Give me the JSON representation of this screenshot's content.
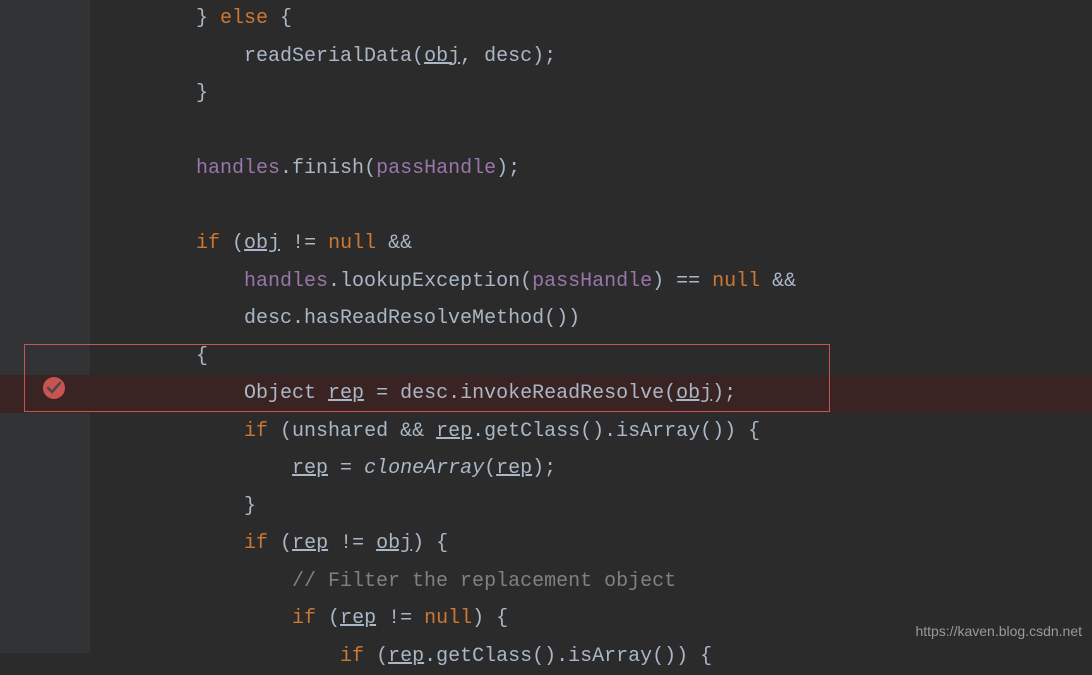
{
  "code": {
    "l0a": "        } ",
    "l0b": "else",
    "l0c": " {",
    "l1a": "            readSerialData(",
    "l1b": "obj",
    "l1c": ", desc);",
    "l2": "        }",
    "l3": "",
    "l4a": "        ",
    "l4b": "handles",
    "l4c": ".",
    "l4d": "finish",
    "l4e": "(",
    "l4f": "passHandle",
    "l4g": ");",
    "l5": "",
    "l6a": "        ",
    "l6b": "if",
    "l6c": " (",
    "l6d": "obj",
    "l6e": " != ",
    "l6f": "null",
    "l6g": " &&",
    "l7a": "            ",
    "l7b": "handles",
    "l7c": ".lookupException(",
    "l7d": "passHandle",
    "l7e": ") == ",
    "l7f": "null",
    "l7g": " &&",
    "l8a": "            desc.hasReadResolveMethod())",
    "l9": "        {",
    "l10a": "            Object ",
    "l10b": "rep",
    "l10c": " = desc.invokeReadResolve(",
    "l10d": "obj",
    "l10e": ");",
    "l11a": "            ",
    "l11b": "if",
    "l11c": " (unshared && ",
    "l11d": "rep",
    "l11e": ".getClass().isArray()) {",
    "l12a": "                ",
    "l12b": "rep",
    "l12c": " = ",
    "l12d": "cloneArray",
    "l12e": "(",
    "l12f": "rep",
    "l12g": ");",
    "l13": "            }",
    "l14a": "            ",
    "l14b": "if",
    "l14c": " (",
    "l14d": "rep",
    "l14e": " != ",
    "l14f": "obj",
    "l14g": ") {",
    "l15a": "                ",
    "l15b": "// Filter the replacement object",
    "l16a": "                ",
    "l16b": "if",
    "l16c": " (",
    "l16d": "rep",
    "l16e": " != ",
    "l16f": "null",
    "l16g": ") {",
    "l17a": "                    ",
    "l17b": "if",
    "l17c": " (",
    "l17d": "rep",
    "l17e": ".getClass().isArray()) {"
  },
  "watermark": "https://kaven.blog.csdn.net"
}
